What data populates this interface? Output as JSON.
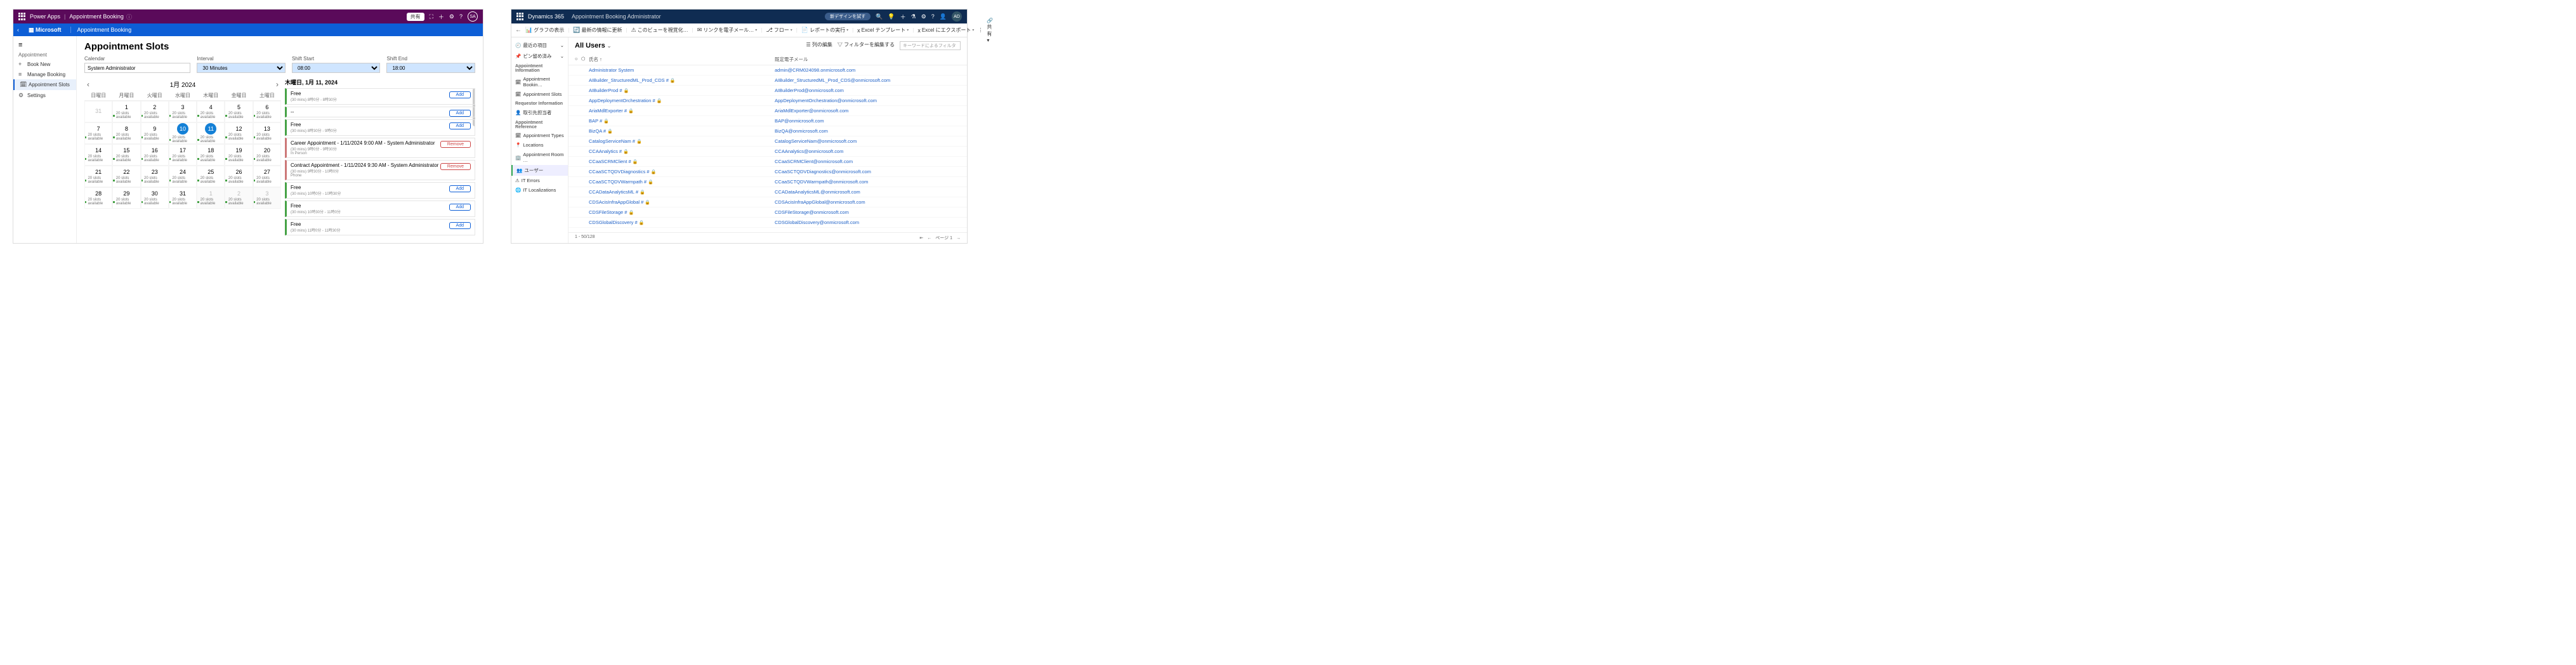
{
  "screen1": {
    "topbar": {
      "brand": "Power Apps",
      "app": "Appointment Booking",
      "share": "共有",
      "avatar": "SA"
    },
    "bluebar": {
      "ms": "Microsoft",
      "app": "Appointment Booking"
    },
    "nav": {
      "group": "Appointment",
      "items": [
        {
          "icon": "+",
          "label": "Book New"
        },
        {
          "icon": "≡",
          "label": "Manage Booking"
        },
        {
          "icon": "🗓",
          "label": "Appointment Slots",
          "sel": true
        },
        {
          "icon": "⚙",
          "label": "Settings"
        }
      ]
    },
    "title": "Appointment Slots",
    "filters": {
      "calendar": {
        "label": "Calendar",
        "value": "System Administrator"
      },
      "interval": {
        "label": "Interval",
        "value": "30 Minutes"
      },
      "shiftStart": {
        "label": "Shift Start",
        "value": "08:00"
      },
      "shiftEnd": {
        "label": "Shift End",
        "value": "18:00"
      }
    },
    "calendar": {
      "month": "1月 2024",
      "dow": [
        "日曜日",
        "月曜日",
        "火曜日",
        "水曜日",
        "木曜日",
        "金曜日",
        "土曜日"
      ],
      "avail_label": "20 slots available",
      "weeks": [
        [
          {
            "d": "31",
            "out": true
          },
          {
            "d": "1",
            "a": true
          },
          {
            "d": "2",
            "a": true
          },
          {
            "d": "3",
            "a": true
          },
          {
            "d": "4",
            "a": true
          },
          {
            "d": "5",
            "a": true
          },
          {
            "d": "6",
            "a": true
          }
        ],
        [
          {
            "d": "7",
            "a": true
          },
          {
            "d": "8",
            "a": true
          },
          {
            "d": "9",
            "a": true
          },
          {
            "d": "10",
            "a": true,
            "sel": true
          },
          {
            "d": "11",
            "a": true,
            "sel": true
          },
          {
            "d": "12",
            "a": true
          },
          {
            "d": "13",
            "a": true
          }
        ],
        [
          {
            "d": "14",
            "a": true
          },
          {
            "d": "15",
            "a": true
          },
          {
            "d": "16",
            "a": true
          },
          {
            "d": "17",
            "a": true
          },
          {
            "d": "18",
            "a": true
          },
          {
            "d": "19",
            "a": true
          },
          {
            "d": "20",
            "a": true
          }
        ],
        [
          {
            "d": "21",
            "a": true
          },
          {
            "d": "22",
            "a": true
          },
          {
            "d": "23",
            "a": true
          },
          {
            "d": "24",
            "a": true
          },
          {
            "d": "25",
            "a": true
          },
          {
            "d": "26",
            "a": true
          },
          {
            "d": "27",
            "a": true
          }
        ],
        [
          {
            "d": "28",
            "a": true
          },
          {
            "d": "29",
            "a": true
          },
          {
            "d": "30",
            "a": true
          },
          {
            "d": "31",
            "a": true
          },
          {
            "d": "1",
            "out": true,
            "outbg": true,
            "a": true
          },
          {
            "d": "2",
            "out": true,
            "outbg": true,
            "a": true
          },
          {
            "d": "3",
            "out": true,
            "outbg": true,
            "a": true
          }
        ]
      ]
    },
    "slots": {
      "date_header": "木曜日, 1月 11, 2024",
      "items": [
        {
          "title": "Free",
          "sub": "(30 mins) 8時0分 - 8時30分",
          "btn": "Add"
        },
        {
          "title": "--",
          "sub": "",
          "btn": "Add"
        },
        {
          "title": "Free",
          "sub": "(30 mins) 8時30分 - 9時0分",
          "btn": "Add"
        },
        {
          "title": "Career Appointment - 1/11/2024 9:00 AM - System Administrator",
          "sub": "(30 mins) 9時0分 - 9時30分",
          "sub2": "In Person",
          "btn": "Remove",
          "booked": true
        },
        {
          "title": "Contract Appointment - 1/11/2024 9:30 AM - System Administrator",
          "sub": "(30 mins) 9時30分 - 10時0分",
          "sub2": "Phone",
          "btn": "Remove",
          "booked": true
        },
        {
          "title": "Free",
          "sub": "(30 mins) 10時0分 - 10時30分",
          "btn": "Add"
        },
        {
          "title": "Free",
          "sub": "(30 mins) 10時30分 - 11時0分",
          "btn": "Add"
        },
        {
          "title": "Free",
          "sub": "(30 mins) 11時0分 - 11時30分",
          "btn": "Add"
        }
      ]
    }
  },
  "screen2": {
    "topbar": {
      "brand": "Dynamics 365",
      "app": "Appointment Booking Administrator",
      "promo": "新デザインを試す",
      "avatar": "AD"
    },
    "cmd": {
      "items": [
        {
          "ic": "📊",
          "label": "グラフの表示"
        },
        {
          "ic": "🔄",
          "label": "最新の情報に更新"
        },
        {
          "ic": "⚠",
          "label": "このビューを視覚化…"
        },
        {
          "ic": "✉",
          "label": "リンクを電子メール…",
          "caret": true
        },
        {
          "ic": "⎇",
          "label": "フロー",
          "caret": true
        },
        {
          "ic": "📄",
          "label": "レポートの実行",
          "caret": true
        },
        {
          "ic": "x",
          "label": "Excel テンプレート",
          "caret": true
        },
        {
          "ic": "x",
          "label": "Excel にエクスポート",
          "caret": true
        }
      ],
      "share": "共有"
    },
    "nav": {
      "recent": {
        "ic": "🕘",
        "label": "最近の項目"
      },
      "pinned": {
        "ic": "📌",
        "label": "ピン留め済み"
      },
      "groups": [
        {
          "header": "Appointment Information",
          "items": [
            {
              "ic": "🗓",
              "label": "Appointment Bookin…"
            },
            {
              "ic": "🗓",
              "label": "Appointment Slots"
            }
          ]
        },
        {
          "header": "Requestor Information",
          "items": [
            {
              "ic": "👤",
              "label": "取引先担当者"
            }
          ]
        },
        {
          "header": "Appointment Reference",
          "items": [
            {
              "ic": "🗓",
              "label": "Appointment Types"
            },
            {
              "ic": "📍",
              "label": "Locations"
            },
            {
              "ic": "🏢",
              "label": "Appointment Room …"
            },
            {
              "ic": "👥",
              "label": "ユーザー",
              "sel": true
            },
            {
              "ic": "⚠",
              "label": "IT Errors"
            },
            {
              "ic": "🌐",
              "label": "IT Localizations"
            }
          ]
        }
      ]
    },
    "view": {
      "title": "All Users",
      "edit_cols": "列の編集",
      "edit_filters": "フィルターを編集する",
      "search": "キーワードによるフィルタ"
    },
    "cols": {
      "name": "氏名 ↑",
      "email": "既定電子メール"
    },
    "rows": [
      {
        "name": "Administrator System",
        "email": "admin@CRM024098.onmicrosoft.com",
        "lock": false
      },
      {
        "name": "AIBuilder_StructuredML_Prod_CDS #",
        "email": "AIBuilder_StructuredML_Prod_CDS@onmicrosoft.com",
        "lock": true
      },
      {
        "name": "AIBuilderProd #",
        "email": "AIBuilderProd@onmicrosoft.com",
        "lock": true
      },
      {
        "name": "AppDeploymentOrchestration #",
        "email": "AppDeploymentOrchestration@onmicrosoft.com",
        "lock": true
      },
      {
        "name": "AriaMdlExporter #",
        "email": "AriaMdlExporter@onmicrosoft.com",
        "lock": true
      },
      {
        "name": "BAP #",
        "email": "BAP@onmicrosoft.com",
        "lock": true
      },
      {
        "name": "BizQA #",
        "email": "BizQA@onmicrosoft.com",
        "lock": true
      },
      {
        "name": "CatalogServiceNam #",
        "email": "CatalogServiceNam@onmicrosoft.com",
        "lock": true
      },
      {
        "name": "CCAAnalytics #",
        "email": "CCAAnalytics@onmicrosoft.com",
        "lock": true
      },
      {
        "name": "CCaaSCRMClient #",
        "email": "CCaaSCRMClient@onmicrosoft.com",
        "lock": true
      },
      {
        "name": "CCaaSCTQDVDiagnostics #",
        "email": "CCaaSCTQDVDiagnostics@onmicrosoft.com",
        "lock": true
      },
      {
        "name": "CCaaSCTQDVWarmpath #",
        "email": "CCaaSCTQDVWarmpath@onmicrosoft.com",
        "lock": true
      },
      {
        "name": "CCADataAnalyticsML #",
        "email": "CCADataAnalyticsML@onmicrosoft.com",
        "lock": true
      },
      {
        "name": "CDSAcisInfraAppGlobal #",
        "email": "CDSAcisInfraAppGlobal@onmicrosoft.com",
        "lock": true
      },
      {
        "name": "CDSFileStorage #",
        "email": "CDSFileStorage@onmicrosoft.com",
        "lock": true
      },
      {
        "name": "CDSGlobalDiscovery #",
        "email": "CDSGlobalDiscovery@onmicrosoft.com",
        "lock": true
      }
    ],
    "footer": {
      "count": "1 - 50/128",
      "page": "ページ 1"
    }
  }
}
